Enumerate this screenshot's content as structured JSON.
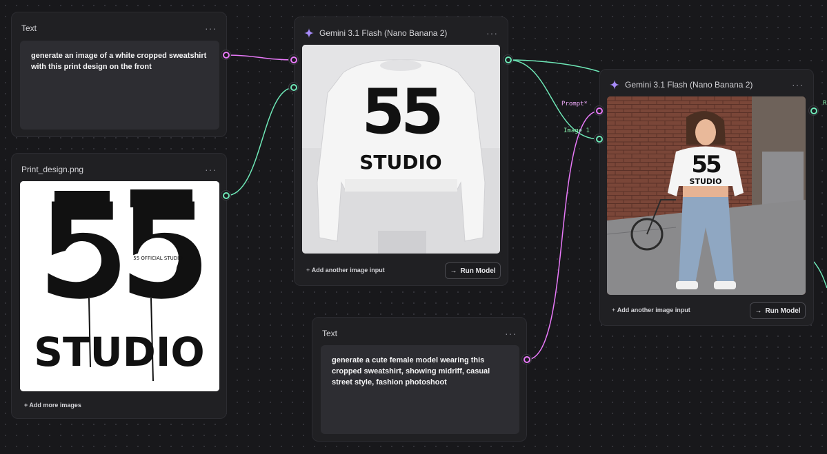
{
  "menu_glyph": "···",
  "colors": {
    "prompt_wire": "#e879f9",
    "image_wire": "#6ee7b7",
    "accent_sparkle": "#a78bfa"
  },
  "nodes": {
    "text1": {
      "title": "Text",
      "content": "generate an image of a white cropped sweatshirt with this print design on the front"
    },
    "print": {
      "title": "Print_design.png",
      "add_more": "+ Add more images",
      "image": {
        "digits": "55",
        "word": "STUDIO",
        "circle_text": "55 OFFICIAL STUDIO"
      }
    },
    "gemini1": {
      "title": "Gemini 3.1 Flash (Nano Banana 2)",
      "add_input": "Add another image input",
      "run": "Run Model",
      "image": {
        "digits": "55",
        "word": "STUDIO"
      }
    },
    "text2": {
      "title": "Text",
      "content": "generate a cute female model wearing this cropped sweatshirt, showing midriff, casual street style, fashion photoshoot"
    },
    "gemini2": {
      "title": "Gemini 3.1 Flash (Nano Banana 2)",
      "add_input": "Add another image input",
      "run": "Run Model",
      "port_prompt": "Prompt*",
      "port_image": "Image 1",
      "edge_label": "R",
      "image": {
        "digits": "55",
        "word": "STUDIO"
      }
    }
  }
}
